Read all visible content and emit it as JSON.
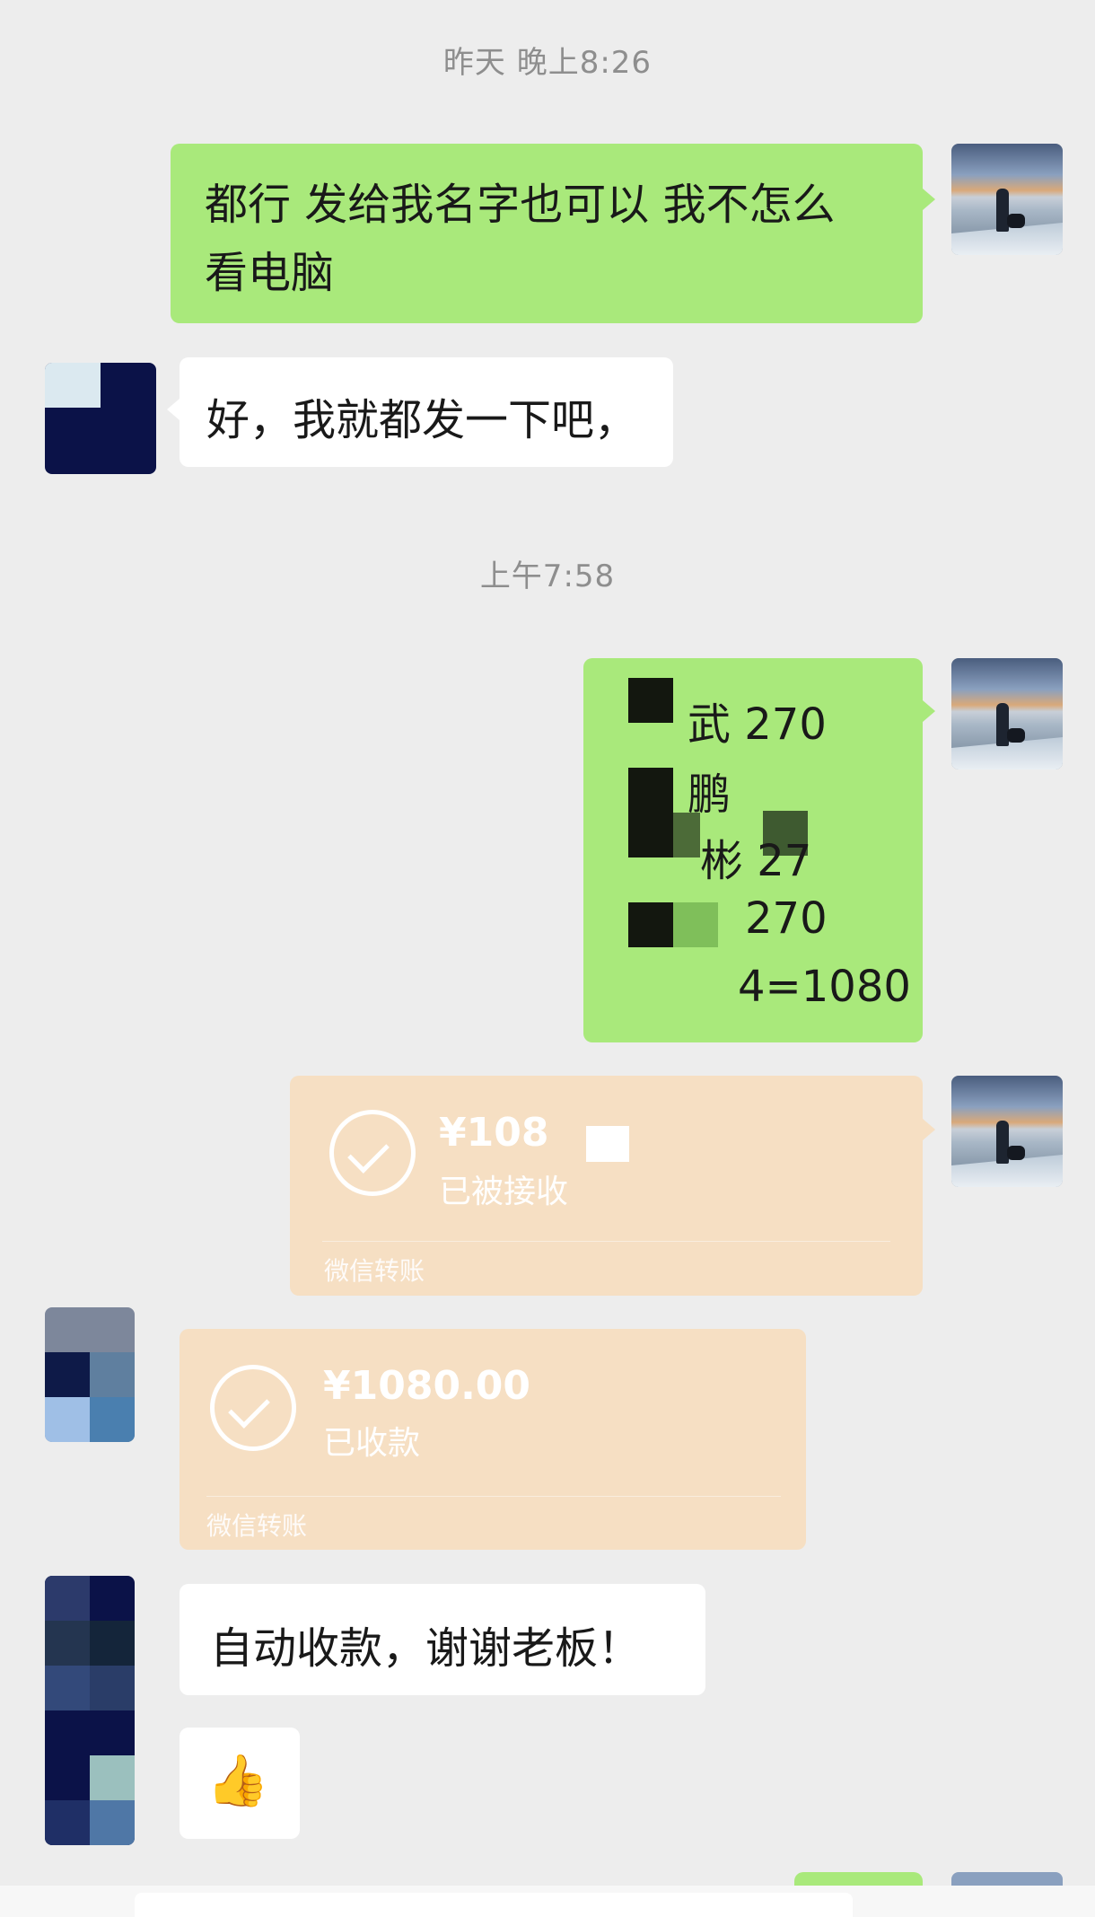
{
  "timestamps": {
    "first": "昨天 晚上8:26",
    "second": "上午7:58"
  },
  "messages": {
    "m1_text": "都行 发给我名字也可以 我不怎么看电脑",
    "m1_line1": "都行 发给我名字也可以 我不怎么",
    "m1_line2": "看电脑",
    "m2_text": "好，我就都发一下吧，",
    "list": {
      "line1": "武 270",
      "line2": "鹏",
      "line3": "彬 27",
      "line4": "270",
      "line5": "4=1080"
    },
    "transfer_sent": {
      "amount": "¥108",
      "status": "已被接收",
      "label": "微信转账"
    },
    "transfer_received": {
      "amount": "¥1080.00",
      "status": "已收款",
      "label": "微信转账"
    },
    "m_thanks": "自动收款，谢谢老板！",
    "m_emoji": "👍"
  },
  "colors": {
    "background": "#ededed",
    "sent_bubble": "#a9e97b",
    "received_bubble": "#ffffff",
    "transfer_card": "#f6dfc3",
    "timestamp_text": "#8e8e8e"
  }
}
